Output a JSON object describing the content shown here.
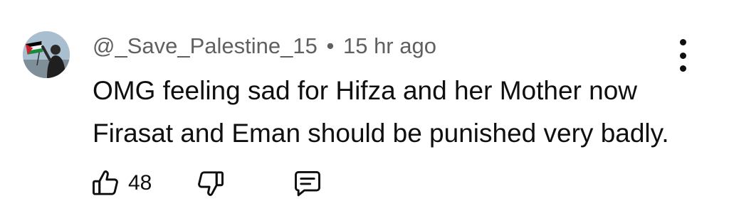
{
  "comment": {
    "author": "@_Save_Palestine_15",
    "separator": "•",
    "timestamp": "15 hr ago",
    "text_lines": [
      "OMG feeling sad for Hifza and her Mother now",
      "Firasat and Eman should be punished very badly."
    ],
    "like_count": "48"
  },
  "icons": {
    "like": "thumbs-up-icon",
    "dislike": "thumbs-down-icon",
    "reply": "comment-reply-icon",
    "more": "more-vertical-icon"
  },
  "colors": {
    "text_primary": "#0f0f0f",
    "text_secondary": "#606060",
    "background": "#ffffff"
  }
}
